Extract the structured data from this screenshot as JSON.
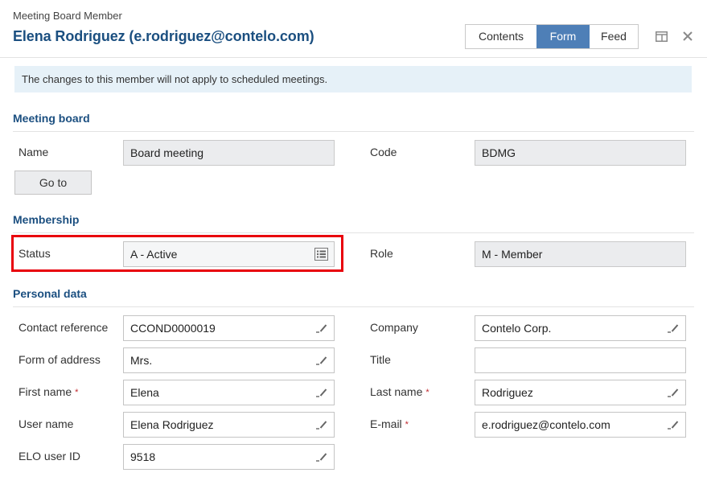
{
  "header": {
    "subtitle": "Meeting Board Member",
    "title": "Elena Rodriguez (e.rodriguez@contelo.com)",
    "tabs": [
      {
        "label": "Contents",
        "active": false
      },
      {
        "label": "Form",
        "active": true
      },
      {
        "label": "Feed",
        "active": false
      }
    ],
    "icons": [
      "layout-icon",
      "close-icon"
    ]
  },
  "info_message": "The changes to this member will not apply to scheduled meetings.",
  "sections": {
    "meeting_board": {
      "title": "Meeting board",
      "name_label": "Name",
      "name_value": "Board meeting",
      "code_label": "Code",
      "code_value": "BDMG",
      "goto_label": "Go to"
    },
    "membership": {
      "title": "Membership",
      "status_label": "Status",
      "status_value": "A - Active",
      "role_label": "Role",
      "role_value": "M - Member"
    },
    "personal_data": {
      "title": "Personal data",
      "contact_reference_label": "Contact reference",
      "contact_reference_value": "CCOND0000019",
      "company_label": "Company",
      "company_value": "Contelo Corp.",
      "form_of_address_label": "Form of address",
      "form_of_address_value": "Mrs.",
      "title_label": "Title",
      "title_value": "",
      "first_name_label": "First name",
      "first_name_value": "Elena",
      "last_name_label": "Last name",
      "last_name_value": "Rodriguez",
      "user_name_label": "User name",
      "user_name_value": "Elena Rodriguez",
      "email_label": "E-mail",
      "email_value": "e.rodriguez@contelo.com",
      "elo_user_id_label": "ELO user ID",
      "elo_user_id_value": "9518",
      "required_marker": "*"
    }
  },
  "colors": {
    "accent": "#1b4f80",
    "active_tab": "#4e7fb7",
    "info_bg": "#e6f1f8",
    "highlight": "#e8000b",
    "required": "#c0282d"
  }
}
